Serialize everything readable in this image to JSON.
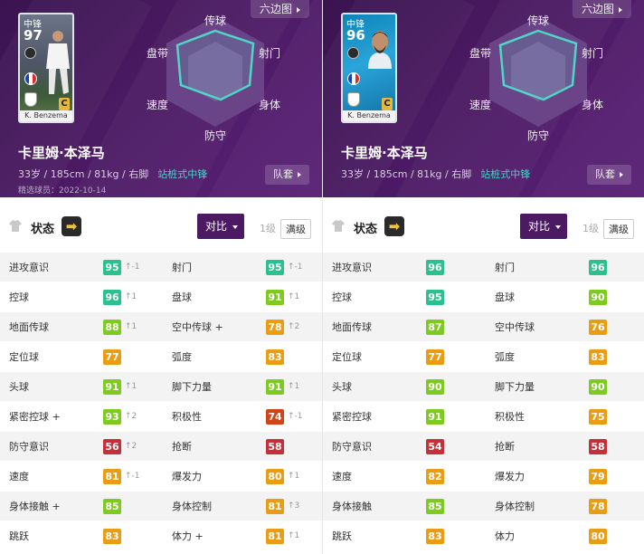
{
  "colors": {
    "tier95": "#2ac18f",
    "tier90": "#7ccb1e",
    "tier80": "#ea9c13",
    "tier70": "#d14418",
    "tier50": "#c62f37",
    "accent_purple": "#4b1a63",
    "role_teal": "#3fd9c8"
  },
  "panels": [
    {
      "hex_button": "六边图",
      "card": {
        "position": "中锋",
        "rating": "97",
        "grade": "C",
        "name": "K. Benzema",
        "variant": "v1"
      },
      "radar_labels": {
        "top": "传球",
        "upper_left": "盘带",
        "upper_right": "射门",
        "lower_left": "速度",
        "lower_right": "身体",
        "bottom": "防守"
      },
      "player_name": "卡里姆·本泽马",
      "meta": "33岁 / 185cm / 81kg / 右脚",
      "role": "站桩式中锋",
      "date": "精选球员：2022-10-14",
      "squad_button": "队套",
      "status_title": "状态",
      "condition_icon": "arrow-right-icon",
      "compare_button": "对比",
      "level1": "1级",
      "level_max": "满级",
      "stats": [
        [
          {
            "name": "进攻意识",
            "value": 95,
            "delta": "↑-1"
          },
          {
            "name": "射门",
            "value": 95,
            "delta": "↑-1"
          }
        ],
        [
          {
            "name": "控球",
            "value": 96,
            "delta": "↑1"
          },
          {
            "name": "盘球",
            "value": 91,
            "delta": "↑1"
          }
        ],
        [
          {
            "name": "地面传球",
            "value": 88,
            "delta": "↑1"
          },
          {
            "name": "空中传球 +",
            "value": 78,
            "delta": "↑2"
          }
        ],
        [
          {
            "name": "定位球",
            "value": 77,
            "delta": ""
          },
          {
            "name": "弧度",
            "value": 83,
            "delta": ""
          }
        ],
        [
          {
            "name": "头球",
            "value": 91,
            "delta": "↑1"
          },
          {
            "name": "脚下力量",
            "value": 91,
            "delta": "↑1"
          }
        ],
        [
          {
            "name": "紧密控球 +",
            "value": 93,
            "delta": "↑2"
          },
          {
            "name": "积极性",
            "value": 74,
            "delta": "↑-1"
          }
        ],
        [
          {
            "name": "防守意识",
            "value": 56,
            "delta": "↑2"
          },
          {
            "name": "抢断",
            "value": 58,
            "delta": ""
          }
        ],
        [
          {
            "name": "速度",
            "value": 81,
            "delta": "↑-1"
          },
          {
            "name": "爆发力",
            "value": 80,
            "delta": "↑1"
          }
        ],
        [
          {
            "name": "身体接触 +",
            "value": 85,
            "delta": ""
          },
          {
            "name": "身体控制",
            "value": 81,
            "delta": "↑3"
          }
        ],
        [
          {
            "name": "跳跃",
            "value": 83,
            "delta": ""
          },
          {
            "name": "体力 +",
            "value": 81,
            "delta": "↑1"
          }
        ]
      ]
    },
    {
      "hex_button": "六边图",
      "card": {
        "position": "中锋",
        "rating": "96",
        "grade": "C",
        "name": "K. Benzema",
        "variant": "v2"
      },
      "radar_labels": {
        "top": "传球",
        "upper_left": "盘带",
        "upper_right": "射门",
        "lower_left": "速度",
        "lower_right": "身体",
        "bottom": "防守"
      },
      "player_name": "卡里姆·本泽马",
      "meta": "33岁 / 185cm / 81kg / 右脚",
      "role": "站桩式中锋",
      "date": "",
      "squad_button": "队套",
      "status_title": "状态",
      "condition_icon": "arrow-right-icon",
      "compare_button": "对比",
      "level1": "1级",
      "level_max": "满级",
      "stats": [
        [
          {
            "name": "进攻意识",
            "value": 96,
            "delta": ""
          },
          {
            "name": "射门",
            "value": 96,
            "delta": ""
          }
        ],
        [
          {
            "name": "控球",
            "value": 95,
            "delta": ""
          },
          {
            "name": "盘球",
            "value": 90,
            "delta": ""
          }
        ],
        [
          {
            "name": "地面传球",
            "value": 87,
            "delta": ""
          },
          {
            "name": "空中传球",
            "value": 76,
            "delta": ""
          }
        ],
        [
          {
            "name": "定位球",
            "value": 77,
            "delta": ""
          },
          {
            "name": "弧度",
            "value": 83,
            "delta": ""
          }
        ],
        [
          {
            "name": "头球",
            "value": 90,
            "delta": ""
          },
          {
            "name": "脚下力量",
            "value": 90,
            "delta": ""
          }
        ],
        [
          {
            "name": "紧密控球",
            "value": 91,
            "delta": ""
          },
          {
            "name": "积极性",
            "value": 75,
            "delta": ""
          }
        ],
        [
          {
            "name": "防守意识",
            "value": 54,
            "delta": ""
          },
          {
            "name": "抢断",
            "value": 58,
            "delta": ""
          }
        ],
        [
          {
            "name": "速度",
            "value": 82,
            "delta": ""
          },
          {
            "name": "爆发力",
            "value": 79,
            "delta": ""
          }
        ],
        [
          {
            "name": "身体接触",
            "value": 85,
            "delta": ""
          },
          {
            "name": "身体控制",
            "value": 78,
            "delta": ""
          }
        ],
        [
          {
            "name": "跳跃",
            "value": 83,
            "delta": ""
          },
          {
            "name": "体力",
            "value": 80,
            "delta": ""
          }
        ]
      ]
    }
  ]
}
